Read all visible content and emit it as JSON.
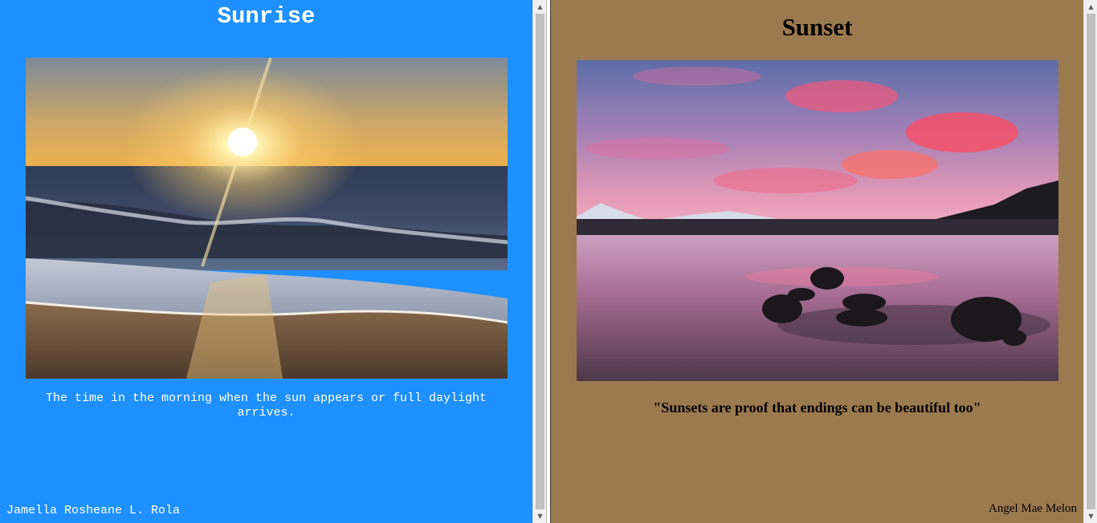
{
  "left_frame": {
    "title": "Sunrise",
    "caption": "The time in the morning when the sun appears or full daylight arrives.",
    "author": "Jamella Rosheane L. Rola",
    "background_color": "#1e90ff",
    "photo": "sunrise over ocean waves on a beach"
  },
  "right_frame": {
    "title": "Sunset",
    "quote": "\"Sunsets are proof that endings can be beautiful too\"",
    "author": "Angel Mae Melon",
    "background_color": "#9b7a4f",
    "photo": "pink sunset clouds over a lake with rocks"
  },
  "scrollbars": {
    "up_icon": "scroll-up-arrow-icon",
    "down_icon": "scroll-down-arrow-icon"
  }
}
